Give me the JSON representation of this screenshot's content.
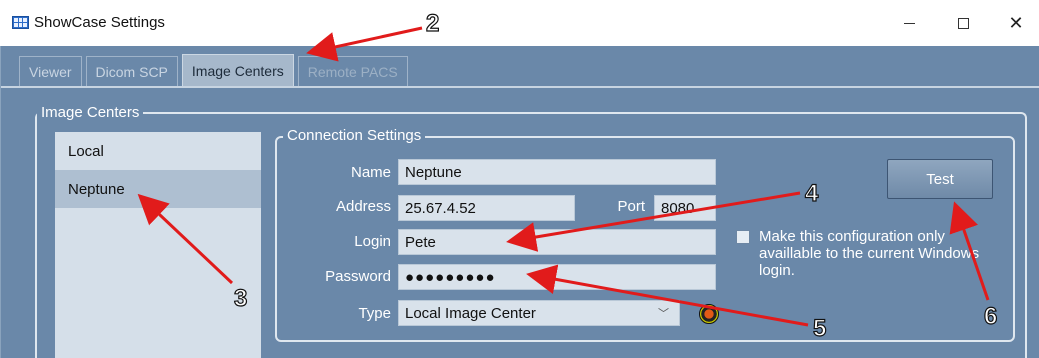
{
  "window": {
    "title": "ShowCase Settings",
    "minimize_glyph": "—",
    "maximize_glyph": "☐",
    "close_glyph": "✕"
  },
  "tabs": [
    {
      "label": "Viewer",
      "state": "inactive"
    },
    {
      "label": "Dicom SCP",
      "state": "inactive"
    },
    {
      "label": "Image Centers",
      "state": "active"
    },
    {
      "label": "Remote PACS",
      "state": "disabled"
    }
  ],
  "image_centers": {
    "group_title": "Image Centers",
    "list": [
      {
        "label": "Local",
        "selected": false
      },
      {
        "label": "Neptune",
        "selected": true
      }
    ]
  },
  "connection": {
    "group_title": "Connection Settings",
    "name_label": "Name",
    "name_value": "Neptune",
    "address_label": "Address",
    "address_value": "25.67.4.52",
    "port_label": "Port",
    "port_value": "8080",
    "login_label": "Login",
    "login_value": "Pete",
    "password_label": "Password",
    "password_value": "●●●●●●●●●",
    "type_label": "Type",
    "type_value": "Local Image Center",
    "test_button": "Test",
    "checkbox_label": "Make this configuration only availlable to the current Windows login.",
    "checkbox_checked": false
  },
  "annotations": {
    "numbers": [
      "2",
      "3",
      "4",
      "5",
      "6"
    ],
    "arrow_color": "#e11b1b"
  },
  "colors": {
    "panel_bg": "#6a88a9",
    "list_bg": "#d5dfe9",
    "field_bg": "#d9e2eb"
  }
}
